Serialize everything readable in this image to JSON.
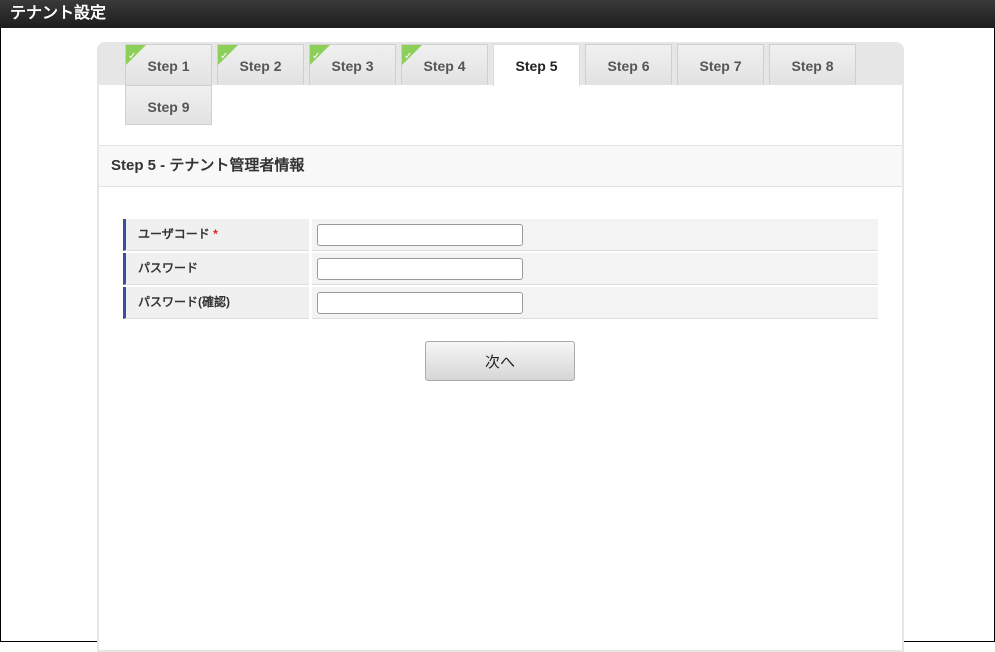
{
  "window": {
    "title": "テナント設定"
  },
  "tabs": [
    {
      "label": "Step 1",
      "completed": true
    },
    {
      "label": "Step 2",
      "completed": true
    },
    {
      "label": "Step 3",
      "completed": true
    },
    {
      "label": "Step 4",
      "completed": true
    },
    {
      "label": "Step 5",
      "active": true
    },
    {
      "label": "Step 6"
    },
    {
      "label": "Step 7"
    },
    {
      "label": "Step 8"
    },
    {
      "label": "Step 9"
    }
  ],
  "section": {
    "title": "Step 5 - テナント管理者情報"
  },
  "form": {
    "fields": [
      {
        "label": "ユーザコード",
        "required_mark": "*",
        "value": ""
      },
      {
        "label": "パスワード",
        "value": ""
      },
      {
        "label": "パスワード(確認)",
        "value": ""
      }
    ],
    "next_label": "次へ"
  }
}
